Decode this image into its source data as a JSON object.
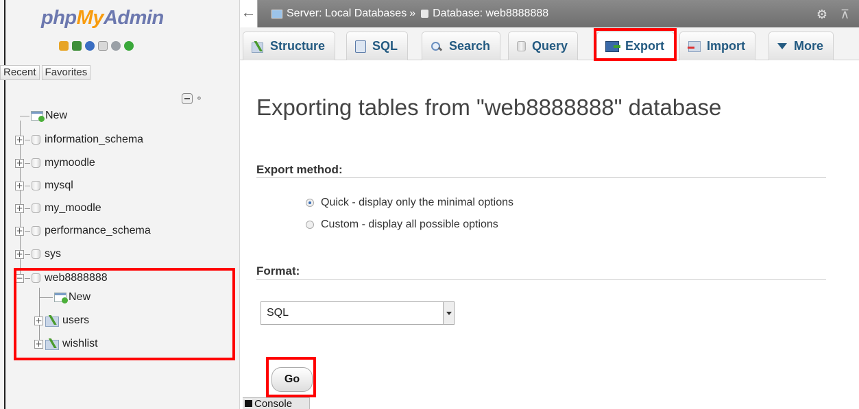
{
  "logo": {
    "php": "php",
    "my": "My",
    "admin": "Admin"
  },
  "nav": {
    "icons": [
      "home-icon",
      "db-icon",
      "help-icon",
      "docs-icon",
      "settings-icon",
      "reload-icon"
    ],
    "tabs": {
      "recent": "Recent",
      "favorites": "Favorites"
    },
    "tree": [
      {
        "label": "New",
        "icon": "new-icon"
      },
      {
        "label": "information_schema",
        "icon": "database-icon"
      },
      {
        "label": "mymoodle",
        "icon": "database-icon"
      },
      {
        "label": "mysql",
        "icon": "database-icon"
      },
      {
        "label": "my_moodle",
        "icon": "database-icon"
      },
      {
        "label": "performance_schema",
        "icon": "database-icon"
      },
      {
        "label": "sys",
        "icon": "database-icon"
      },
      {
        "label": "web8888888",
        "icon": "database-icon"
      }
    ],
    "subtree": [
      {
        "label": "New",
        "icon": "new-icon"
      },
      {
        "label": "users",
        "icon": "table-icon"
      },
      {
        "label": "wishlist",
        "icon": "table-icon"
      }
    ]
  },
  "breadcrumb": {
    "server": "Server: Local Databases",
    "separator": "»",
    "database": "Database: web8888888"
  },
  "tabs": {
    "structure": "Structure",
    "sql": "SQL",
    "search": "Search",
    "query": "Query",
    "export": "Export",
    "import": "Import",
    "more": "More"
  },
  "page": {
    "title": "Exporting tables from \"web8888888\" database",
    "export_method_label": "Export method:",
    "quick_option": "Quick - display only the minimal options",
    "custom_option": "Custom - display all possible options",
    "selected_method": "Quick - display only the minimal options",
    "format_label": "Format:",
    "format_value": "SQL",
    "go_label": "Go"
  },
  "console": {
    "label": "Console"
  },
  "colors": {
    "highlight": "#ff0000",
    "link": "#235a81",
    "logo_blue": "#6c78af",
    "logo_orange": "#f89c0e"
  }
}
